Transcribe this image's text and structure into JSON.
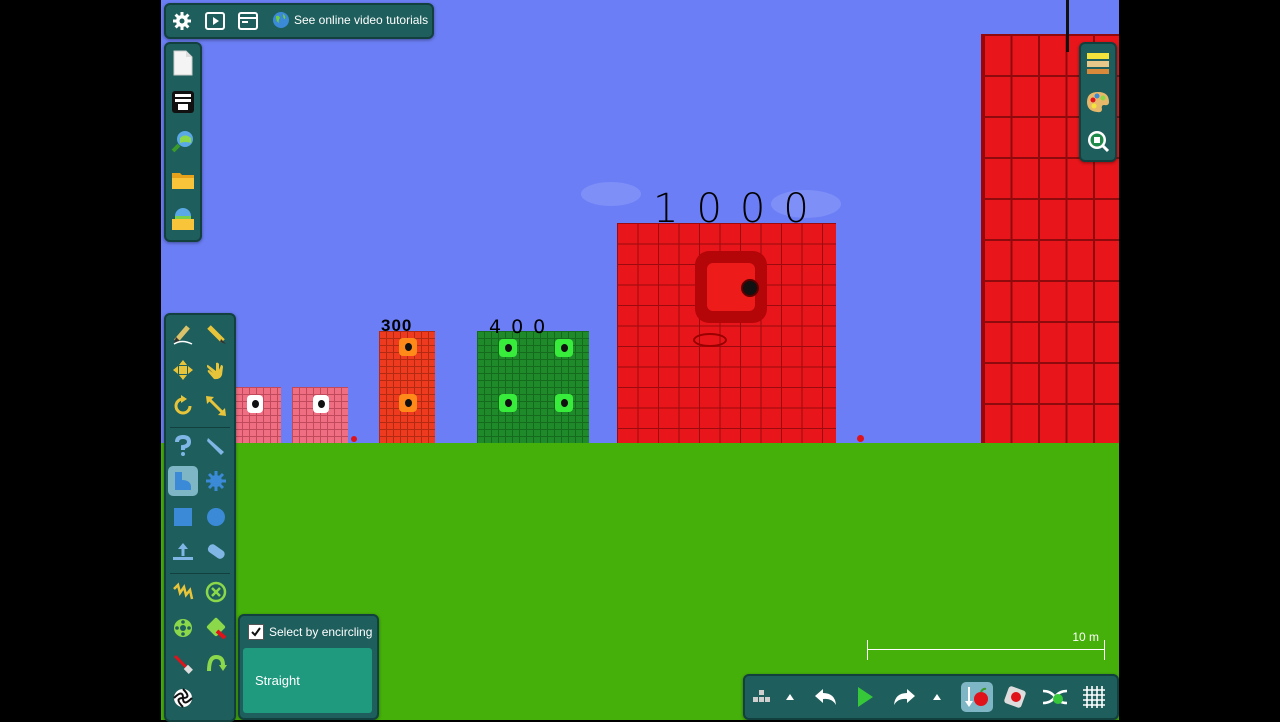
{
  "top_bar": {
    "tutorials_link": "See online video tutorials"
  },
  "canvas": {
    "handwritten_labels": {
      "block_300": "300",
      "block_400": "400",
      "block_1000": "1000"
    },
    "scale_bar_label": "10 m"
  },
  "encircle_panel": {
    "checkbox_label": "Select by encircling",
    "checked": true,
    "mode_button": "Straight"
  },
  "colors": {
    "sky": "#6b7ef5",
    "ground": "#46b00a",
    "panel": "#1e5e5c",
    "active_tool": "#7fb6c6"
  }
}
